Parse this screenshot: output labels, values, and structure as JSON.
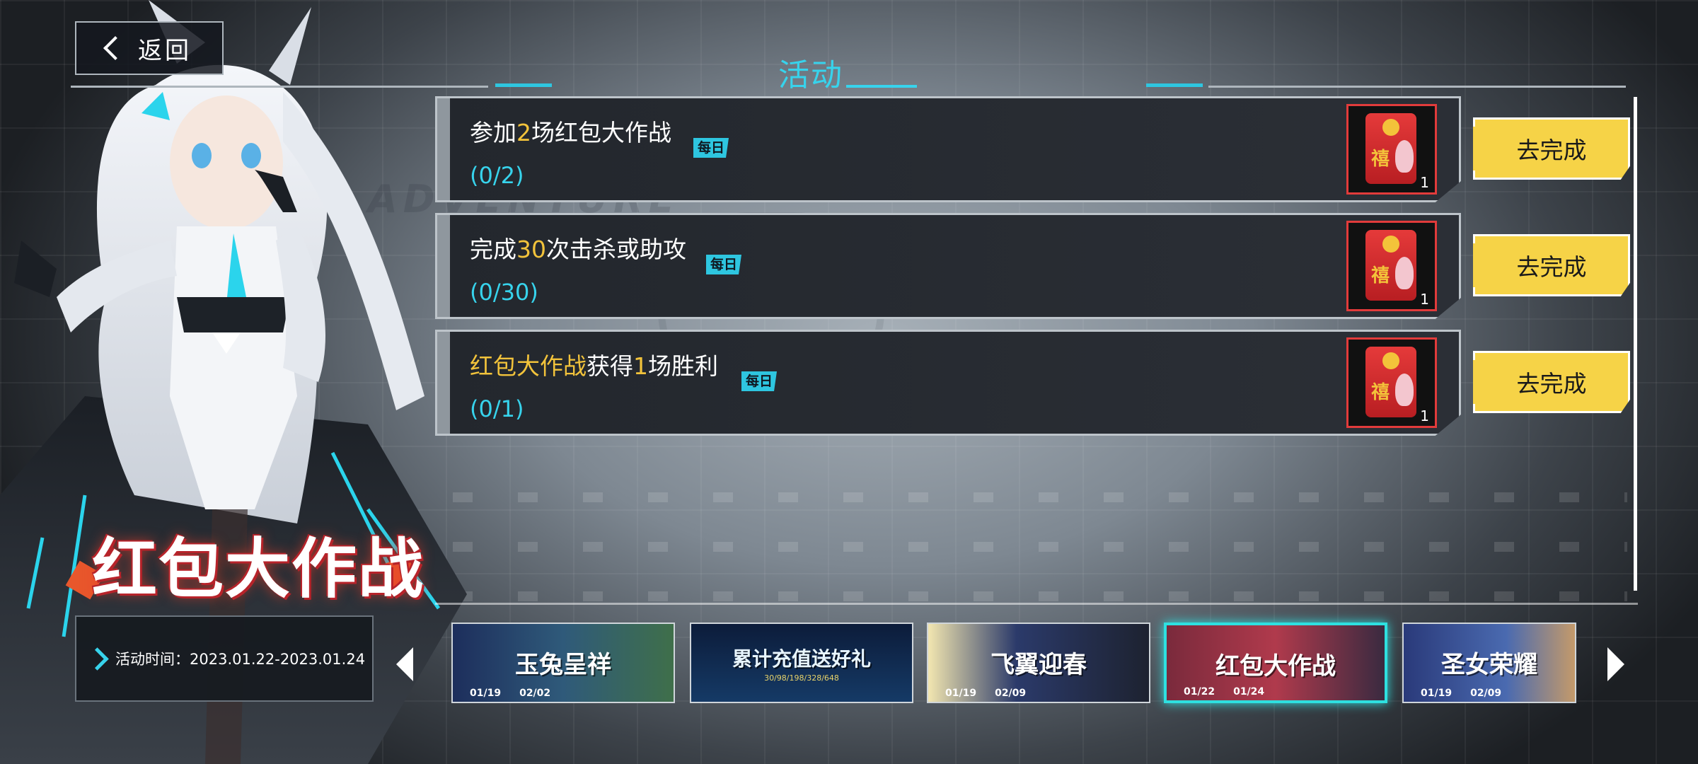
{
  "header": {
    "back_label": "返回",
    "title": "活动"
  },
  "event": {
    "title": "红包大作战",
    "time_label": "活动时间：",
    "time_value": "2023.01.22-2023.01.24"
  },
  "tasks": [
    {
      "parts": [
        "参加",
        "2",
        "场红包大作战"
      ],
      "highlight": [
        false,
        true,
        false
      ],
      "daily": "每日",
      "progress": "(0/2)",
      "reward_count": "1",
      "button": "去完成"
    },
    {
      "parts": [
        "完成",
        "30",
        "次击杀或助攻"
      ],
      "highlight": [
        false,
        true,
        false
      ],
      "daily": "每日",
      "progress": "(0/30)",
      "reward_count": "1",
      "button": "去完成"
    },
    {
      "parts": [
        "红包大作战",
        "获得",
        "1",
        "场胜利"
      ],
      "highlight": [
        true,
        false,
        true,
        false
      ],
      "daily": "每日",
      "progress": "(0/1)",
      "reward_count": "1",
      "button": "去完成"
    }
  ],
  "reward_icon": "red-envelope-rabbit-icon",
  "reward_glyph": "禧",
  "banners": [
    {
      "title": "玉兔呈祥",
      "start": "01/19",
      "end": "02/02",
      "sub": ""
    },
    {
      "title": "累计充值送好礼",
      "start": "",
      "end": "",
      "sub": "30/98/198/328/648"
    },
    {
      "title": "飞翼迎春",
      "start": "01/19",
      "end": "02/09",
      "sub": ""
    },
    {
      "title": "红包大作战",
      "start": "01/22",
      "end": "01/24",
      "sub": ""
    },
    {
      "title": "圣女荣耀",
      "start": "01/19",
      "end": "02/09",
      "sub": ""
    }
  ],
  "colors": {
    "accent": "#37d3ec",
    "highlight": "#f2c33b",
    "button": "#f6d347",
    "active_banner": "#2ee0e0"
  }
}
